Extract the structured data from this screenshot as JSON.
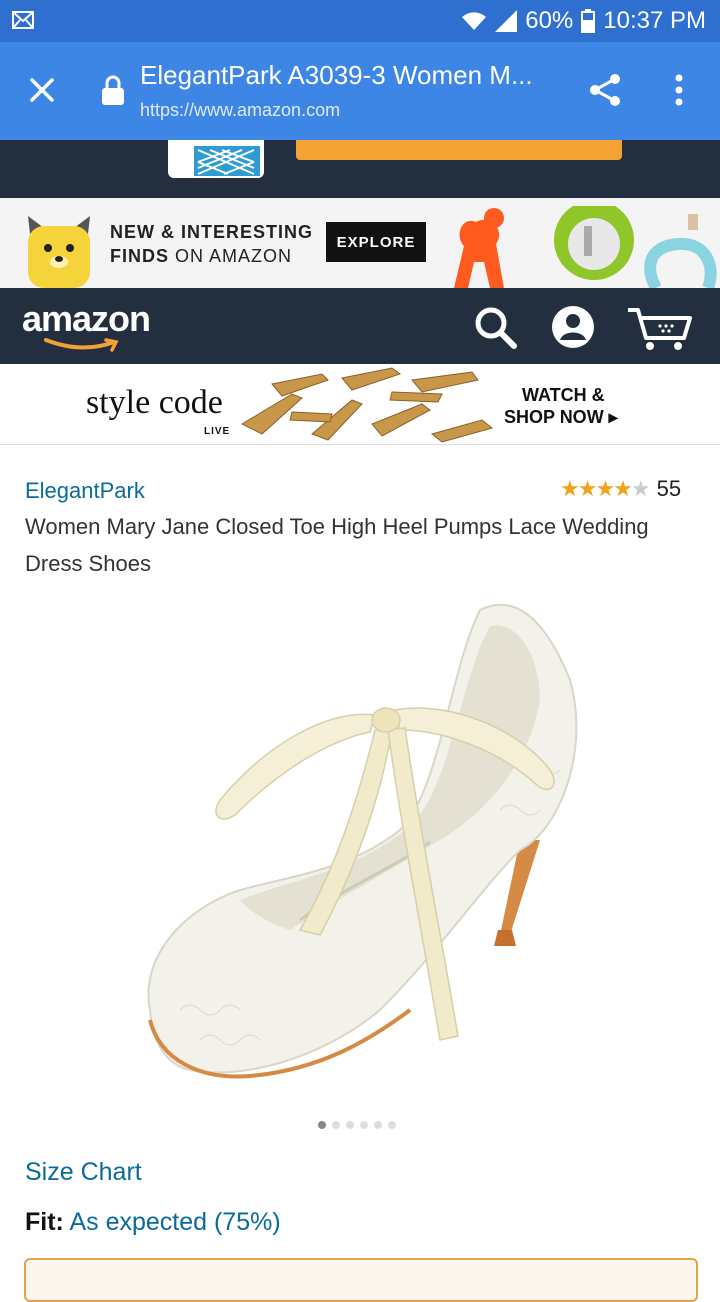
{
  "status_bar": {
    "battery": "60%",
    "time": "10:37 PM"
  },
  "browser": {
    "page_title": "ElegantPark A3039-3 Women M...",
    "url": "https://www.amazon.com"
  },
  "ad_banner": {
    "line1": "NEW & INTERESTING",
    "line2_bold": "FINDS",
    "line2_rest": " ON AMAZON",
    "button": "EXPLORE"
  },
  "header": {
    "logo": "amazon"
  },
  "style_banner": {
    "logo": "style code",
    "logo_sub": "LIVE",
    "cta_line1": "WATCH &",
    "cta_line2": "SHOP NOW ▸"
  },
  "product": {
    "brand": "ElegantPark",
    "rating": 4,
    "rating_max": 5,
    "review_count": "55",
    "title": "Women Mary Jane Closed Toe High Heel Pumps Lace Wedding Dress Shoes",
    "image_count": 6,
    "active_image": 1
  },
  "details": {
    "size_chart": "Size Chart",
    "fit_label": "Fit:",
    "fit_value": "As expected (75%)"
  },
  "colors": {
    "status_bar": "#2f6fd0",
    "browser_bar": "#3d86e6",
    "amazon_dark": "#232f3e",
    "link": "#0a6a9a",
    "star": "#f2a31b",
    "amazon_orange": "#f3a333"
  }
}
